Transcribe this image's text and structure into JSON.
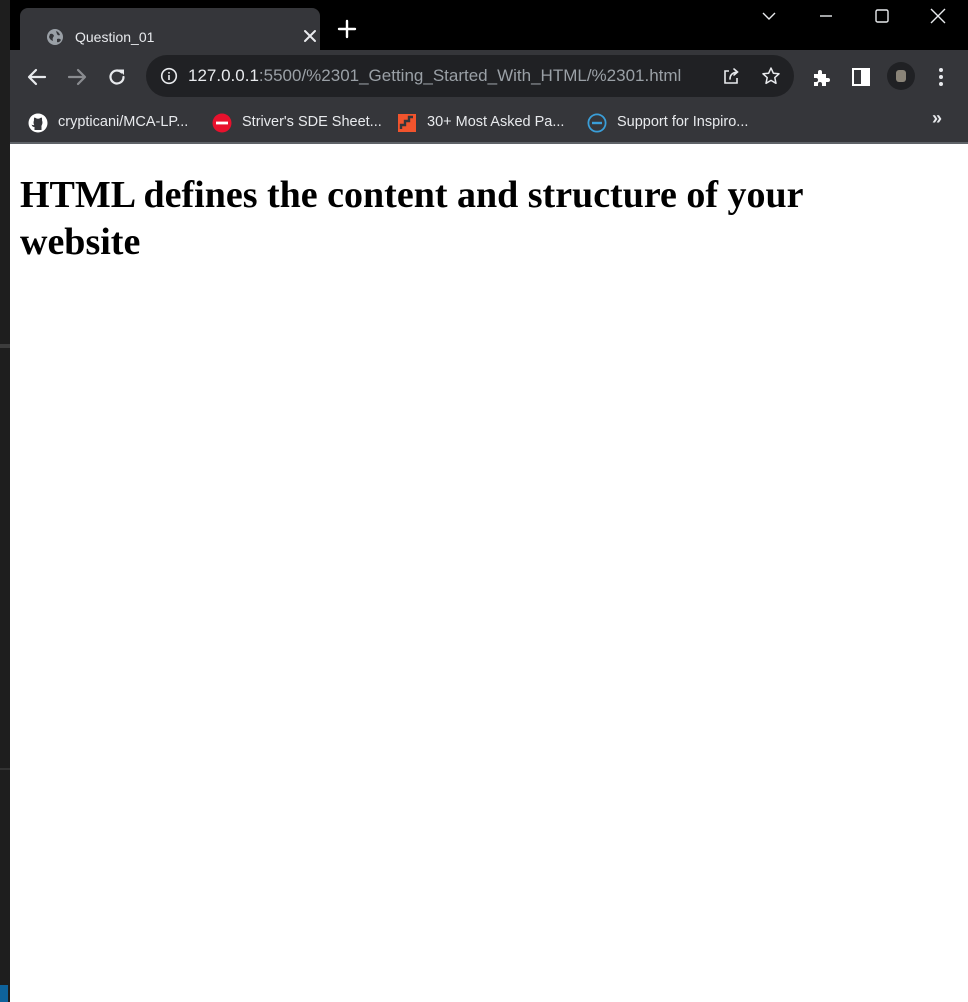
{
  "browser": {
    "tab": {
      "title": "Question_01"
    },
    "address_bar": {
      "host": "127.0.0.1",
      "path": ":5500/%2301_Getting_Started_With_HTML/%2301.html"
    },
    "bookmarks": [
      {
        "label": "crypticani/MCA-LP...",
        "icon": "github-icon"
      },
      {
        "label": "Striver's SDE Sheet...",
        "icon": "tuf-icon"
      },
      {
        "label": "30+ Most Asked Pa...",
        "icon": "stairs-logo-icon"
      },
      {
        "label": "Support for Inspiro...",
        "icon": "dell-icon"
      }
    ],
    "bookmarks_overflow": "»"
  },
  "page": {
    "heading": "HTML defines the content and structure of your website"
  },
  "colors": {
    "tabstrip": "#000000",
    "toolbar": "#35363a",
    "omnibox": "#202124",
    "text_light": "#e8eaed",
    "text_dim": "#9aa0a6"
  }
}
